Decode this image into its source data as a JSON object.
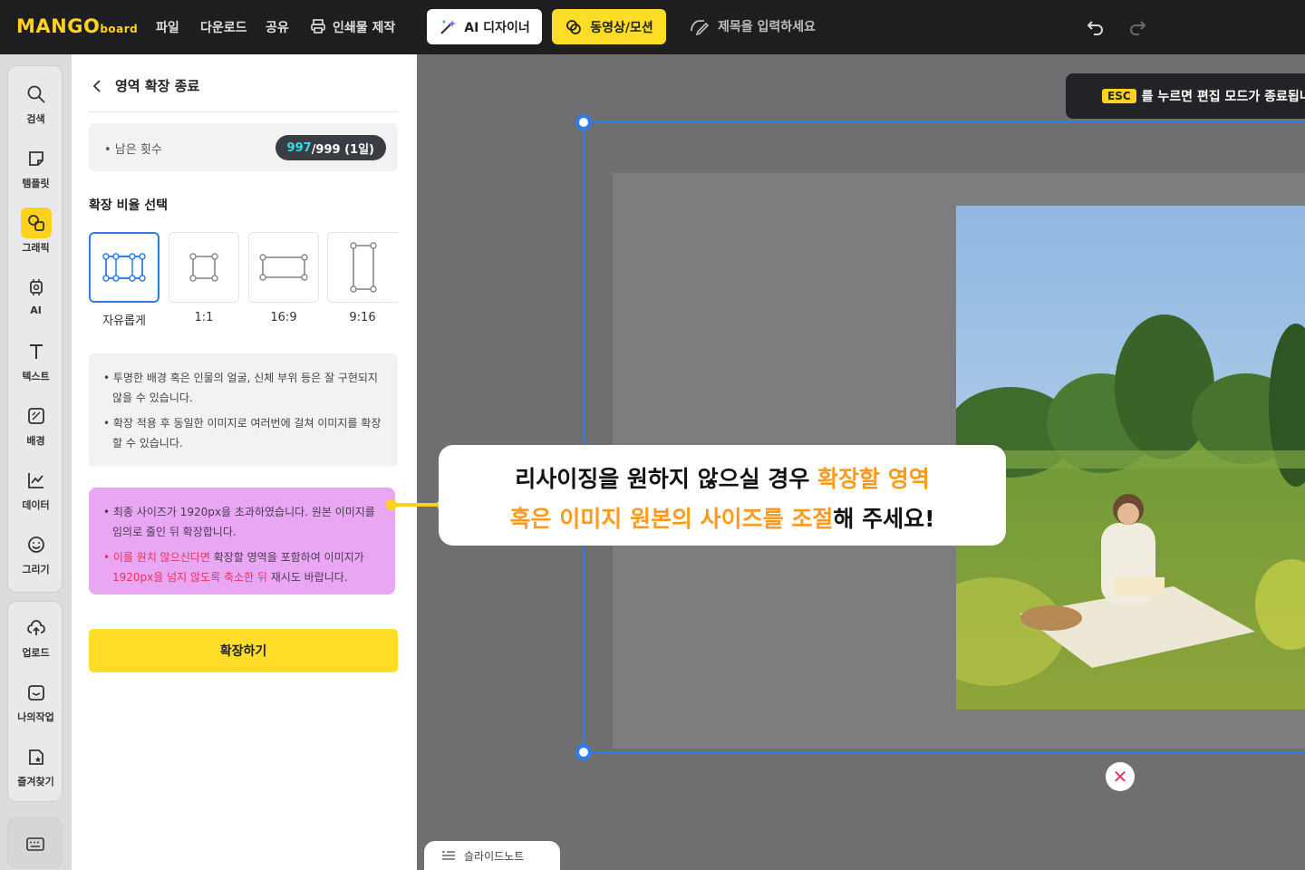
{
  "topbar": {
    "logo": "MANGO",
    "logo_sub": "board",
    "menu": [
      "파일",
      "다운로드",
      "공유",
      "인쇄물 제작"
    ],
    "ai_designer": "AI 디자이너",
    "video_motion": "동영상/모션",
    "title_placeholder": "제목을 입력하세요"
  },
  "rail": {
    "items": [
      "검색",
      "템플릿",
      "그래픽",
      "AI",
      "텍스트",
      "배경",
      "데이터",
      "그리기",
      "업로드",
      "나의작업",
      "즐겨찾기"
    ]
  },
  "panel": {
    "header": "영역 확장 종료",
    "remain_label": "• 남은 횟수",
    "remain_current": "997",
    "remain_total": "/999 (1일)",
    "ratio_title": "확장 비율 선택",
    "ratios": [
      "자유롭게",
      "1:1",
      "16:9",
      "9:16"
    ],
    "notice1": [
      "• 투명한 배경 혹은 인물의 얼굴, 신체 부위 등은 잘 구현되지 않을 수 있습니다.",
      "• 확장 적용 후 동일한 이미지로 여러번에 걸쳐 이미지를 확장할 수 있습니다."
    ],
    "notice2_line1": "• 최종 사이즈가 1920px을 초과하였습니다. 원본 이미지를 임의로 줄인 뒤 확장합니다.",
    "notice2_red1": "• 이를 원치 않으신다면",
    "notice2_mid": " 확장할 영역을 포함하여 이미지가 ",
    "notice2_red2": "1920px을 넘지 않도록 축소한 뒤",
    "notice2_end": " 재시도 바랍니다.",
    "expand_button": "확장하기"
  },
  "canvas": {
    "esc_key": "ESC",
    "esc_text": "를 누르면 편집 모드가 종료됩니다"
  },
  "callout": {
    "line1_black": "리사이징을 원하지 않으실 경우 ",
    "line1_orange": "확장할 영역",
    "line2_orange": "혹은 이미지 원본의 사이즈를 조절",
    "line2_black": "해 주세요!"
  },
  "footer": {
    "slide_note": "슬라이드노트"
  },
  "colors": {
    "accent_yellow": "#ffdd28",
    "selection_blue": "#2f7be8",
    "notice_pink": "#e9a6f3",
    "highlight_orange": "#ff9a1f"
  }
}
